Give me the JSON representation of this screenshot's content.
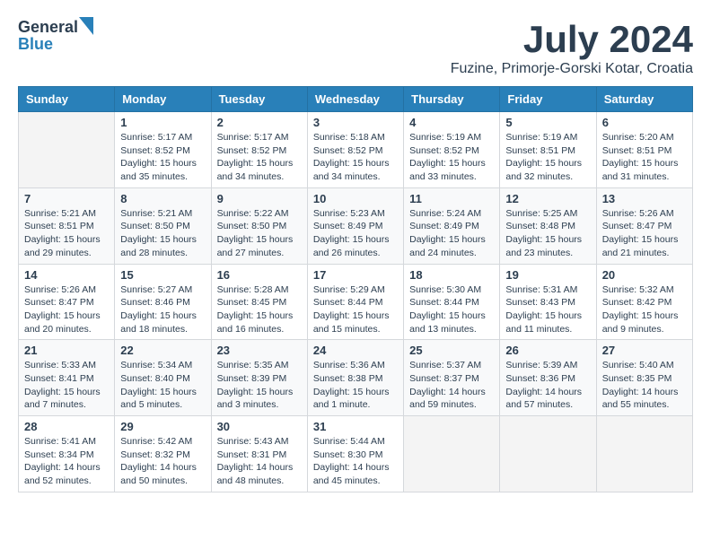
{
  "header": {
    "logo_general": "General",
    "logo_blue": "Blue",
    "title": "July 2024",
    "subtitle": "Fuzine, Primorje-Gorski Kotar, Croatia"
  },
  "calendar": {
    "days_of_week": [
      "Sunday",
      "Monday",
      "Tuesday",
      "Wednesday",
      "Thursday",
      "Friday",
      "Saturday"
    ],
    "weeks": [
      [
        {
          "day": "",
          "info": ""
        },
        {
          "day": "1",
          "info": "Sunrise: 5:17 AM\nSunset: 8:52 PM\nDaylight: 15 hours\nand 35 minutes."
        },
        {
          "day": "2",
          "info": "Sunrise: 5:17 AM\nSunset: 8:52 PM\nDaylight: 15 hours\nand 34 minutes."
        },
        {
          "day": "3",
          "info": "Sunrise: 5:18 AM\nSunset: 8:52 PM\nDaylight: 15 hours\nand 34 minutes."
        },
        {
          "day": "4",
          "info": "Sunrise: 5:19 AM\nSunset: 8:52 PM\nDaylight: 15 hours\nand 33 minutes."
        },
        {
          "day": "5",
          "info": "Sunrise: 5:19 AM\nSunset: 8:51 PM\nDaylight: 15 hours\nand 32 minutes."
        },
        {
          "day": "6",
          "info": "Sunrise: 5:20 AM\nSunset: 8:51 PM\nDaylight: 15 hours\nand 31 minutes."
        }
      ],
      [
        {
          "day": "7",
          "info": "Sunrise: 5:21 AM\nSunset: 8:51 PM\nDaylight: 15 hours\nand 29 minutes."
        },
        {
          "day": "8",
          "info": "Sunrise: 5:21 AM\nSunset: 8:50 PM\nDaylight: 15 hours\nand 28 minutes."
        },
        {
          "day": "9",
          "info": "Sunrise: 5:22 AM\nSunset: 8:50 PM\nDaylight: 15 hours\nand 27 minutes."
        },
        {
          "day": "10",
          "info": "Sunrise: 5:23 AM\nSunset: 8:49 PM\nDaylight: 15 hours\nand 26 minutes."
        },
        {
          "day": "11",
          "info": "Sunrise: 5:24 AM\nSunset: 8:49 PM\nDaylight: 15 hours\nand 24 minutes."
        },
        {
          "day": "12",
          "info": "Sunrise: 5:25 AM\nSunset: 8:48 PM\nDaylight: 15 hours\nand 23 minutes."
        },
        {
          "day": "13",
          "info": "Sunrise: 5:26 AM\nSunset: 8:47 PM\nDaylight: 15 hours\nand 21 minutes."
        }
      ],
      [
        {
          "day": "14",
          "info": "Sunrise: 5:26 AM\nSunset: 8:47 PM\nDaylight: 15 hours\nand 20 minutes."
        },
        {
          "day": "15",
          "info": "Sunrise: 5:27 AM\nSunset: 8:46 PM\nDaylight: 15 hours\nand 18 minutes."
        },
        {
          "day": "16",
          "info": "Sunrise: 5:28 AM\nSunset: 8:45 PM\nDaylight: 15 hours\nand 16 minutes."
        },
        {
          "day": "17",
          "info": "Sunrise: 5:29 AM\nSunset: 8:44 PM\nDaylight: 15 hours\nand 15 minutes."
        },
        {
          "day": "18",
          "info": "Sunrise: 5:30 AM\nSunset: 8:44 PM\nDaylight: 15 hours\nand 13 minutes."
        },
        {
          "day": "19",
          "info": "Sunrise: 5:31 AM\nSunset: 8:43 PM\nDaylight: 15 hours\nand 11 minutes."
        },
        {
          "day": "20",
          "info": "Sunrise: 5:32 AM\nSunset: 8:42 PM\nDaylight: 15 hours\nand 9 minutes."
        }
      ],
      [
        {
          "day": "21",
          "info": "Sunrise: 5:33 AM\nSunset: 8:41 PM\nDaylight: 15 hours\nand 7 minutes."
        },
        {
          "day": "22",
          "info": "Sunrise: 5:34 AM\nSunset: 8:40 PM\nDaylight: 15 hours\nand 5 minutes."
        },
        {
          "day": "23",
          "info": "Sunrise: 5:35 AM\nSunset: 8:39 PM\nDaylight: 15 hours\nand 3 minutes."
        },
        {
          "day": "24",
          "info": "Sunrise: 5:36 AM\nSunset: 8:38 PM\nDaylight: 15 hours\nand 1 minute."
        },
        {
          "day": "25",
          "info": "Sunrise: 5:37 AM\nSunset: 8:37 PM\nDaylight: 14 hours\nand 59 minutes."
        },
        {
          "day": "26",
          "info": "Sunrise: 5:39 AM\nSunset: 8:36 PM\nDaylight: 14 hours\nand 57 minutes."
        },
        {
          "day": "27",
          "info": "Sunrise: 5:40 AM\nSunset: 8:35 PM\nDaylight: 14 hours\nand 55 minutes."
        }
      ],
      [
        {
          "day": "28",
          "info": "Sunrise: 5:41 AM\nSunset: 8:34 PM\nDaylight: 14 hours\nand 52 minutes."
        },
        {
          "day": "29",
          "info": "Sunrise: 5:42 AM\nSunset: 8:32 PM\nDaylight: 14 hours\nand 50 minutes."
        },
        {
          "day": "30",
          "info": "Sunrise: 5:43 AM\nSunset: 8:31 PM\nDaylight: 14 hours\nand 48 minutes."
        },
        {
          "day": "31",
          "info": "Sunrise: 5:44 AM\nSunset: 8:30 PM\nDaylight: 14 hours\nand 45 minutes."
        },
        {
          "day": "",
          "info": ""
        },
        {
          "day": "",
          "info": ""
        },
        {
          "day": "",
          "info": ""
        }
      ]
    ]
  }
}
